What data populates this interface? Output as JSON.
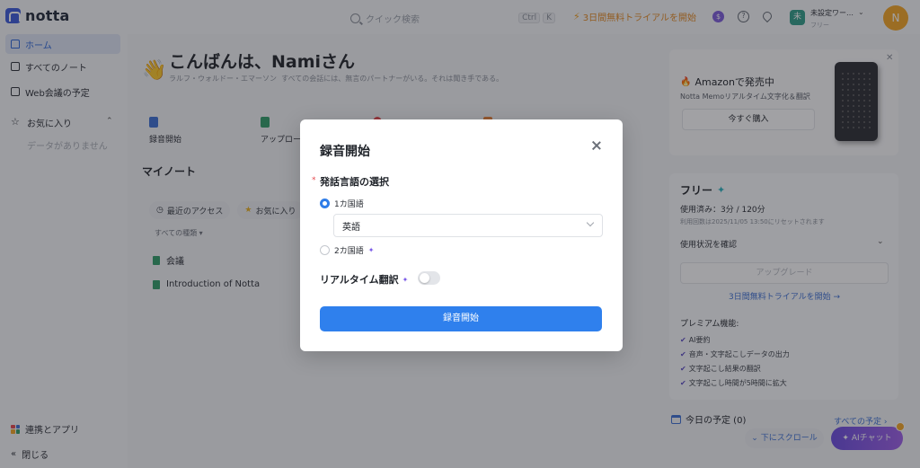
{
  "topbar": {
    "logo_text": "notta",
    "search_placeholder": "クイック検索",
    "kbd_ctrl": "Ctrl",
    "kbd_k": "K",
    "trial_label": "3日間無料トライアルを開始",
    "workspace_badge": "未",
    "workspace_name": "未設定ワー…",
    "workspace_plan": "フリー",
    "avatar_initial": "N"
  },
  "sidebar": {
    "items": [
      {
        "label": "ホーム",
        "active": true
      },
      {
        "label": "すべてのノート"
      },
      {
        "label": "Web会議の予定"
      },
      {
        "label": "お気に入り"
      }
    ],
    "favorites_empty": "データがありません",
    "apps_label": "連携とアプリ",
    "collapse_label": "閉じる"
  },
  "main": {
    "greeting": "こんばんは、Namiさん",
    "quote_author": "ラルフ・ウォルドー・エマーソン",
    "quote_text": "すべての会話には、無言のパートナーがいる。それは聞き手である。",
    "actions": [
      {
        "label": "録音開始",
        "color": "#3b6fd4"
      },
      {
        "label": "アップロー",
        "color": "#2f9e68"
      },
      {
        "label": "",
        "color": "#e5484d"
      },
      {
        "label": "",
        "color": "#e8813a"
      }
    ],
    "my_notes_title": "マイノート",
    "filters": [
      {
        "label": "最近のアクセス"
      },
      {
        "label": "お気に入り"
      }
    ],
    "kind_filter": "すべての種類",
    "notes": [
      {
        "title": "会議"
      },
      {
        "title": "Introduction of Notta"
      }
    ]
  },
  "promo": {
    "title": "Amazonで発売中",
    "subtitle": "Notta Memoリアルタイム文字化＆翻訳",
    "buy_label": "今すぐ購入"
  },
  "plan": {
    "name": "フリー",
    "used": "使用済み：3分 / 120分",
    "reset": "利用回数は2025/11/05 13:50にリセットされます",
    "check_usage": "使用状況を確認",
    "upgrade_label": "アップグレード",
    "trial_link": "3日間無料トライアルを開始 →",
    "premium_title": "プレミアム機能:",
    "features": [
      "AI要約",
      "音声・文字起こしデータの出力",
      "文字起こし結果の翻訳",
      "文字起こし時間が5時間に拡大"
    ]
  },
  "schedule": {
    "title": "今日の予定 (0)",
    "all_link": "すべての予定 ›",
    "scroll_label": "下にスクロール",
    "ai_chat_label": "AIチャット"
  },
  "modal": {
    "title": "録音開始",
    "section_label": "発話言語の選択",
    "required_mark": "*",
    "option_one": "1カ国語",
    "selected_language": "英語",
    "option_two": "2カ国語",
    "realtime_label": "リアルタイム翻訳",
    "realtime_enabled": false,
    "start_label": "録音開始"
  }
}
